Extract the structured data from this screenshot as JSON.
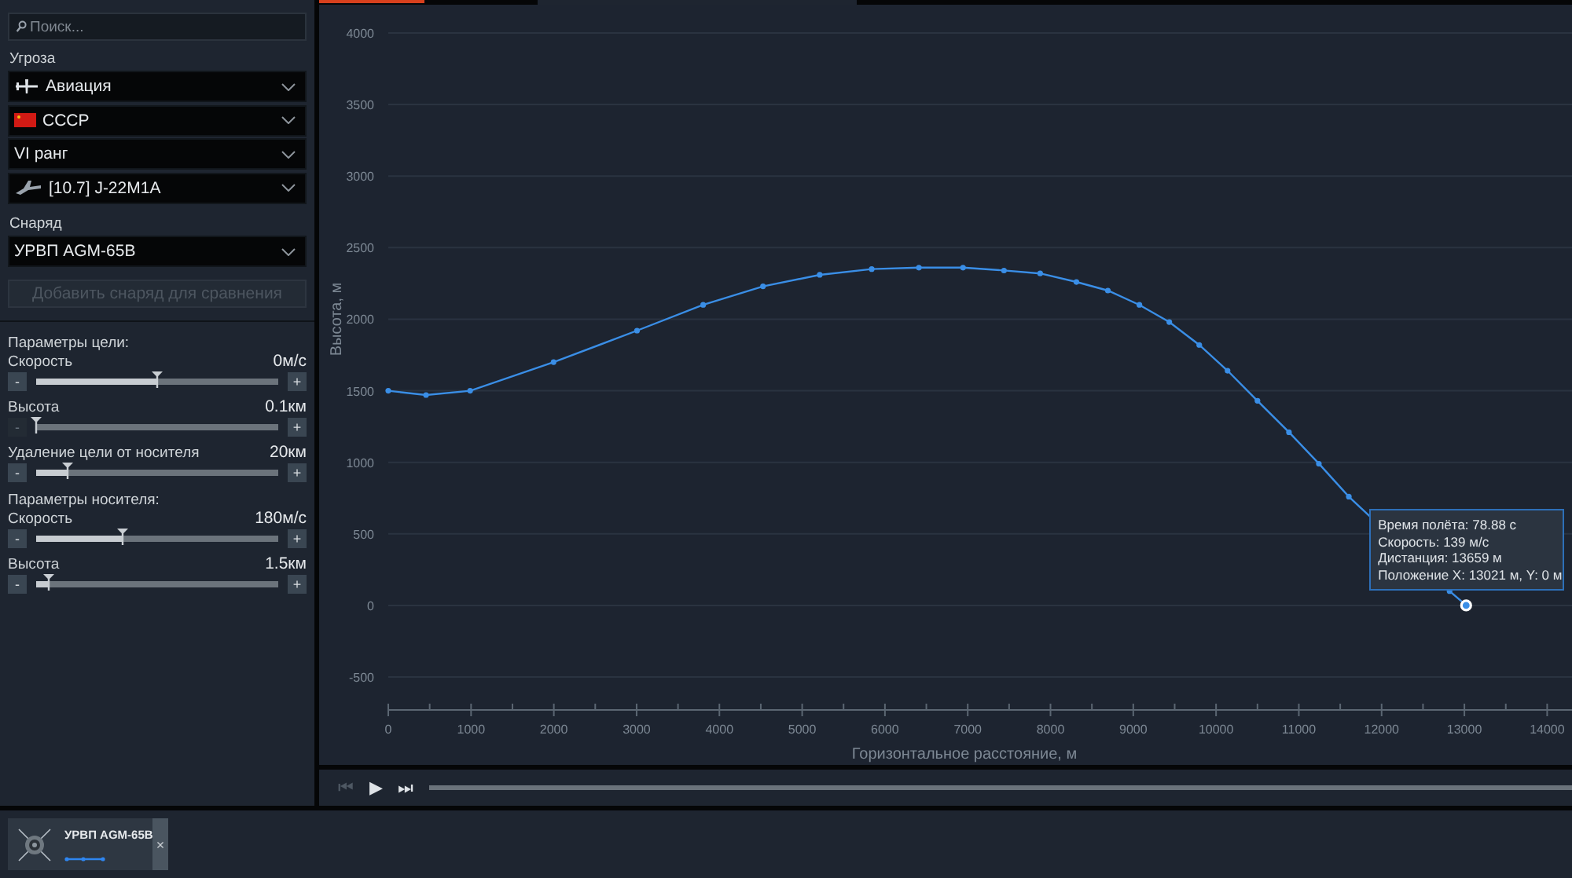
{
  "top_tabs": [
    {
      "selected": true
    },
    {
      "selected": false
    }
  ],
  "sidebar": {
    "search": {
      "placeholder": "Поиск..."
    },
    "threat": {
      "label": "Угроза",
      "dropdowns": [
        {
          "kind": "aircraft",
          "value": "Авиация"
        },
        {
          "kind": "flag",
          "value": "СССР"
        },
        {
          "kind": "plain",
          "value": "VI ранг"
        },
        {
          "kind": "jet",
          "value": "[10.7] J-22M1A"
        }
      ]
    },
    "projectile": {
      "label": "Снаряд",
      "value": "УРВП AGM-65B"
    },
    "add_button": {
      "label": "Добавить снаряд для сравнения",
      "disabled": true
    },
    "groups": [
      {
        "title": "Параметры цели:",
        "sliders": [
          {
            "label": "Скорость",
            "reading": "0м/с",
            "level": 0.5,
            "minus": "-",
            "plus": "+",
            "minus_disabled": false
          },
          {
            "label": "Высота",
            "reading": "0.1км",
            "level": 0.0,
            "minus": "-",
            "plus": "+",
            "minus_disabled": true
          },
          {
            "label": "Удаление цели от носителя",
            "reading": "20км",
            "level": 0.13,
            "minus": "-",
            "plus": "+",
            "minus_disabled": false
          }
        ]
      },
      {
        "title": "Параметры носителя:",
        "sliders": [
          {
            "label": "Скорость",
            "reading": "180м/с",
            "level": 0.36,
            "minus": "-",
            "plus": "+",
            "minus_disabled": false
          },
          {
            "label": "Высота",
            "reading": "1.5км",
            "level": 0.05,
            "minus": "-",
            "plus": "+",
            "minus_disabled": false
          }
        ]
      }
    ]
  },
  "chart": {
    "chart_data": {
      "type": "line",
      "xlabel": "Горизонтальное расстояние, м",
      "ylabel": "Высота, м",
      "x": [
        0,
        456,
        989,
        1997,
        3005,
        3804,
        4527,
        5212,
        5840,
        6410,
        6943,
        7438,
        7875,
        8313,
        8693,
        9074,
        9435,
        9797,
        10139,
        10500,
        10881,
        11242,
        11604,
        12821,
        13021
      ],
      "series": [
        {
          "color": "#3a8ee6",
          "marker": "circle",
          "values": [
            1500,
            1470,
            1500,
            1700,
            1920,
            2100,
            2230,
            2310,
            2350,
            2360,
            2360,
            2340,
            2320,
            2260,
            2200,
            2100,
            1980,
            1820,
            1640,
            1430,
            1210,
            990,
            760,
            100,
            0
          ]
        }
      ],
      "xlim": [
        0,
        14300
      ],
      "ylim": [
        -500,
        4000
      ],
      "grid": true,
      "xticks": [
        0,
        1000,
        2000,
        3000,
        4000,
        5000,
        6000,
        7000,
        8000,
        9000,
        10000,
        11000,
        12000,
        13000,
        14000
      ],
      "yticks": [
        -500,
        0,
        500,
        1000,
        1500,
        2000,
        2500,
        3000,
        3500,
        4000
      ]
    },
    "tooltip": {
      "lines": [
        "Время полёта: 78.88 с",
        "Скорость: 139 м/с",
        "Дистанция: 13659 м",
        "Положение X: 13021 м, Y: 0 м"
      ]
    }
  },
  "playback": {
    "prev": "⏮",
    "play": "▶",
    "next": "⏭",
    "prev_disabled": true
  },
  "comparison_card": {
    "name": "УРВП AGM-65B",
    "close": "×"
  }
}
